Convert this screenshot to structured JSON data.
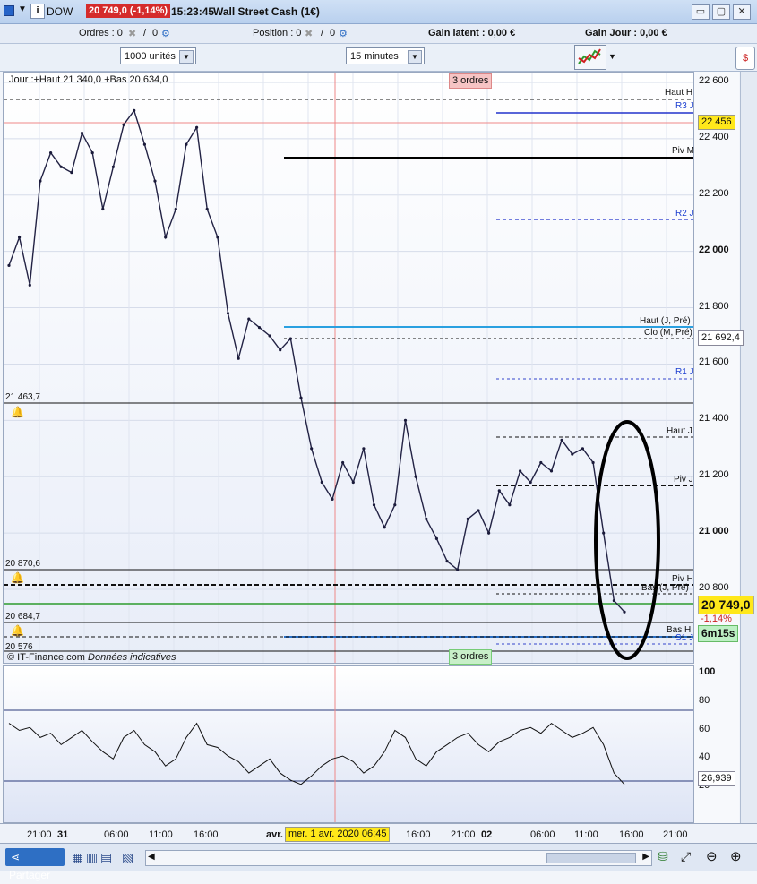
{
  "titlebar": {
    "symbol": "DOW",
    "info": "i",
    "price_badge": "20 749,0 (-1,14%)",
    "time": "15:23:45",
    "instrument": "Wall Street Cash (1€)"
  },
  "orders_bar": {
    "orders_label": "Ordres : 0",
    "orders_value": "0",
    "position_label": "Position : 0",
    "position_value": "0",
    "gain_latent": "Gain latent : 0,00 €",
    "gain_jour": "Gain Jour : 0,00 €"
  },
  "toolbar": {
    "units": "1000 unités",
    "interval": "15 minutes"
  },
  "chart": {
    "header": "Jour :+Haut 21 340,0 +Bas 20 634,0",
    "orders_top": "3 ordres",
    "orders_bottom": "3 ordres",
    "watermark": "© IT-Finance.com",
    "watermark_note": "Données indicatives",
    "price_ticks": [
      "22 600",
      "22 400",
      "22 200",
      "22 000",
      "21 800",
      "21 600",
      "21 400",
      "21 200",
      "21 000",
      "20 800"
    ],
    "current_price": "20 749,0",
    "change": "-1,14%",
    "countdown": "6m15s",
    "cursor_price": "22 456",
    "clo_value": "21 692,4",
    "left_levels": [
      "21 463,7",
      "20 870,6",
      "20 684,7",
      "20 576"
    ],
    "level_labels": {
      "haut_h": "Haut H",
      "r3j": "R3 J",
      "piv_m": "Piv M",
      "r2j": "R2 J",
      "haut_pre": "Haut (J, Pré)",
      "clo_pre": "Clo (M, Pré)",
      "r1j": "R1 J",
      "haut_j": "Haut J",
      "piv_j": "Piv J",
      "piv_h": "Piv H",
      "bas_pre": "Bas (J, Pré)",
      "bas_h": "Bas H",
      "s1j": "S1 J"
    }
  },
  "indicator": {
    "ticks": [
      "100",
      "80",
      "60",
      "40",
      "20"
    ],
    "value": "26,939"
  },
  "time_axis": {
    "labels": [
      "21:00",
      "31",
      "06:00",
      "11:00",
      "16:00",
      "avr.",
      "16:00",
      "21:00",
      "02",
      "06:00",
      "11:00",
      "16:00",
      "21:00"
    ],
    "cursor_date": "mer. 1 avr. 2020 06:45"
  },
  "bottombar": {
    "share": "Partager"
  },
  "chart_data": {
    "type": "line",
    "title": "Wall Street Cash (1€) — 15 minutes",
    "ylim": [
      20500,
      22650
    ],
    "series": [
      {
        "name": "DOW",
        "values": [
          21950,
          22050,
          21880,
          22250,
          22350,
          22300,
          22280,
          22420,
          22350,
          22150,
          22300,
          22450,
          22500,
          22380,
          22250,
          22050,
          22150,
          22380,
          22440,
          22150,
          22050,
          21780,
          21620,
          21760,
          21730,
          21700,
          21650,
          21690,
          21480,
          21300,
          21180,
          21120,
          21250,
          21180,
          21300,
          21100,
          21020,
          21100,
          21400,
          21200,
          21050,
          20980,
          20900,
          20870,
          21050,
          21080,
          21000,
          21150,
          21100,
          21220,
          21180,
          21250,
          21220,
          21330,
          21280,
          21300,
          21250,
          21000,
          20760,
          20720
        ]
      }
    ]
  }
}
